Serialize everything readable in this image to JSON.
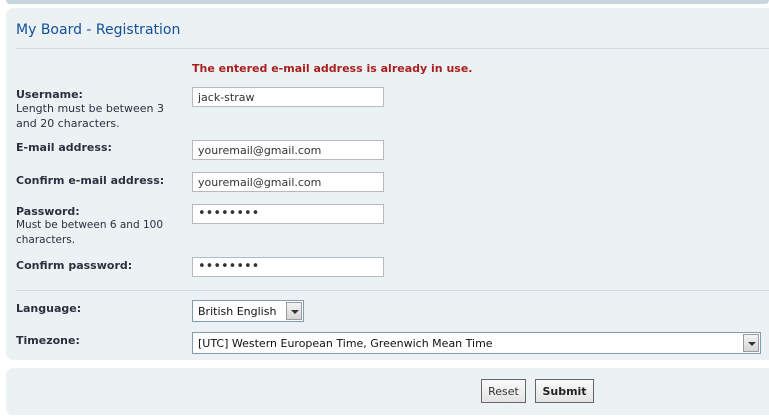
{
  "form": {
    "title": "My Board - Registration",
    "error": "The entered e-mail address is already in use.",
    "username": {
      "label": "Username:",
      "hint": "Length must be between 3 and 20 characters.",
      "value": "jack-straw"
    },
    "email": {
      "label": "E-mail address:",
      "value": "youremail@gmail.com"
    },
    "confirm_email": {
      "label": "Confirm e-mail address:",
      "value": "youremail@gmail.com"
    },
    "password": {
      "label": "Password:",
      "hint": "Must be between 6 and 100 characters.",
      "value": "••••••••"
    },
    "confirm_password": {
      "label": "Confirm password:",
      "value": "••••••••"
    },
    "language": {
      "label": "Language:",
      "selected": "British English"
    },
    "timezone": {
      "label": "Timezone:",
      "selected": "[UTC] Western European Time, Greenwich Mean Time"
    }
  },
  "actions": {
    "reset_label": "Reset",
    "submit_label": "Submit"
  }
}
